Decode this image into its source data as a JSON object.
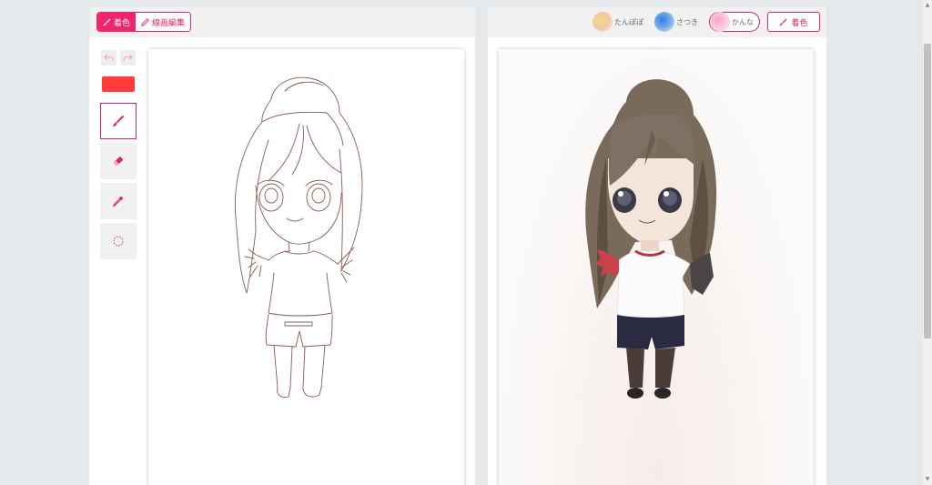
{
  "editor": {
    "modes": [
      {
        "label": "着色",
        "icon": "brush-icon",
        "active": true
      },
      {
        "label": "線画編集",
        "icon": "pencil-icon",
        "active": false
      }
    ],
    "color": "#ff3b3b",
    "tools": [
      {
        "name": "brush",
        "icon": "brush-icon",
        "active": true
      },
      {
        "name": "eraser",
        "icon": "eraser-icon",
        "active": false
      },
      {
        "name": "eyedropper",
        "icon": "eyedropper-icon",
        "active": false
      },
      {
        "name": "lasso",
        "icon": "lasso-icon",
        "active": false
      }
    ]
  },
  "result": {
    "presets": [
      {
        "label": "たんぽぽ",
        "active": false
      },
      {
        "label": "さつき",
        "active": false
      },
      {
        "label": "かんな",
        "active": true
      }
    ],
    "colorize_label": "着色"
  },
  "colors": {
    "accent": "#f0256e",
    "background": "#e6e9ec"
  }
}
